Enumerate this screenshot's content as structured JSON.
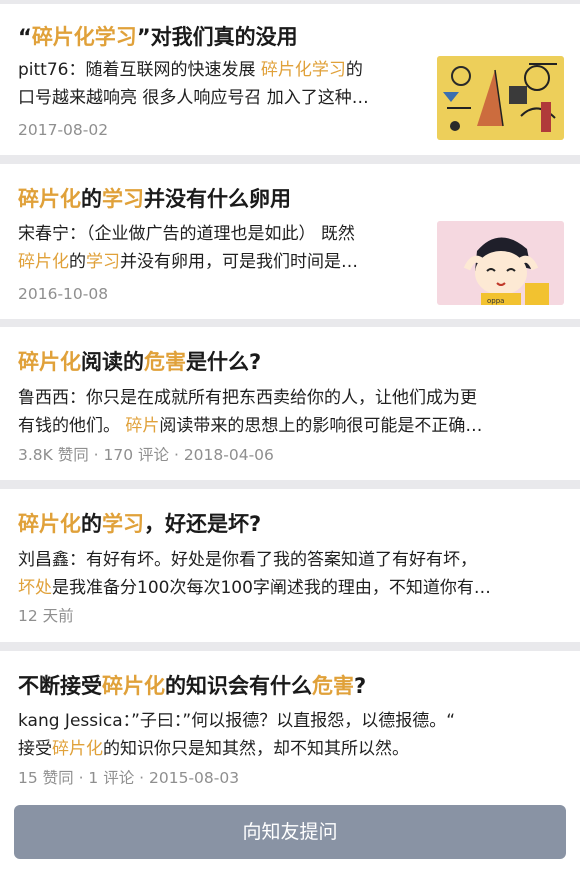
{
  "results": [
    {
      "title": [
        {
          "text": "“",
          "hl": false
        },
        {
          "text": "碎片化学习",
          "hl": true
        },
        {
          "text": "”对我们真的没用",
          "hl": false
        }
      ],
      "excerpt_lines": [
        [
          {
            "text": "pitt76：随着互联网的快速发展 ",
            "hl": false
          },
          {
            "text": "碎片化学习",
            "hl": true
          },
          {
            "text": "的",
            "hl": false
          }
        ],
        [
          {
            "text": "口号越来越响亮 很多人响应号召 加入了这种…",
            "hl": false
          }
        ]
      ],
      "meta": "2017-08-02",
      "thumbnail": "abstract-painting"
    },
    {
      "title": [
        {
          "text": "碎片化",
          "hl": true
        },
        {
          "text": "的",
          "hl": false
        },
        {
          "text": "学习",
          "hl": true
        },
        {
          "text": "并没有什么卵用",
          "hl": false
        }
      ],
      "excerpt_lines": [
        [
          {
            "text": "宋春宁：（企业做广告的道理也是如此） 既然",
            "hl": false
          }
        ],
        [
          {
            "text": "碎片化",
            "hl": true
          },
          {
            "text": "的",
            "hl": false
          },
          {
            "text": "学习",
            "hl": true
          },
          {
            "text": "并没有卵用，可是我们时间是…",
            "hl": false
          }
        ]
      ],
      "meta": "2016-10-08",
      "thumbnail": "cartoon-girl"
    },
    {
      "title": [
        {
          "text": "碎片化",
          "hl": true
        },
        {
          "text": "阅读的",
          "hl": false
        },
        {
          "text": "危害",
          "hl": true
        },
        {
          "text": "是什么?",
          "hl": false
        }
      ],
      "excerpt_lines": [
        [
          {
            "text": "鲁西西：你只是在成就所有把东西卖给你的人，让他们成为更",
            "hl": false
          }
        ],
        [
          {
            "text": "有钱的他们。 ",
            "hl": false
          },
          {
            "text": "碎片",
            "hl": true
          },
          {
            "text": "阅读带来的思想上的影响很可能是不正确…",
            "hl": false
          }
        ]
      ],
      "meta": "3.8K 赞同 · 170 评论 · 2018-04-06",
      "thumbnail": null
    },
    {
      "title": [
        {
          "text": "碎片化",
          "hl": true
        },
        {
          "text": "的",
          "hl": false
        },
        {
          "text": "学习",
          "hl": true
        },
        {
          "text": "，好还是坏?",
          "hl": false
        }
      ],
      "excerpt_lines": [
        [
          {
            "text": "刘昌鑫：有好有坏。好处是你看了我的答案知道了有好有坏，",
            "hl": false
          }
        ],
        [
          {
            "text": "坏处",
            "hl": true
          },
          {
            "text": "是我准备分100次每次100字阐述我的理由，不知道你有…",
            "hl": false
          }
        ]
      ],
      "meta": "12 天前",
      "thumbnail": null
    },
    {
      "title": [
        {
          "text": "不断接受",
          "hl": false
        },
        {
          "text": "碎片化",
          "hl": true
        },
        {
          "text": "的知识会有什么",
          "hl": false
        },
        {
          "text": "危害",
          "hl": true
        },
        {
          "text": "?",
          "hl": false
        }
      ],
      "excerpt_lines": [
        [
          {
            "text": "kang Jessica：”子曰：”何以报德？以直报怨，以德报德。“",
            "hl": false
          }
        ],
        [
          {
            "text": "接受",
            "hl": false
          },
          {
            "text": "碎片化",
            "hl": true
          },
          {
            "text": "的知识你只是知其然，却不知其所以然。",
            "hl": false
          }
        ]
      ],
      "meta": "15 赞同 · 1 评论 · 2015-08-03",
      "thumbnail": null
    }
  ],
  "bottom_bar": {
    "ask_button_label": "向知友提问"
  },
  "colors": {
    "highlight": "#e0a13a",
    "meta_text": "#8f8f8f",
    "button_bg": "#8993a4",
    "page_bg": "#e9e9ec"
  }
}
